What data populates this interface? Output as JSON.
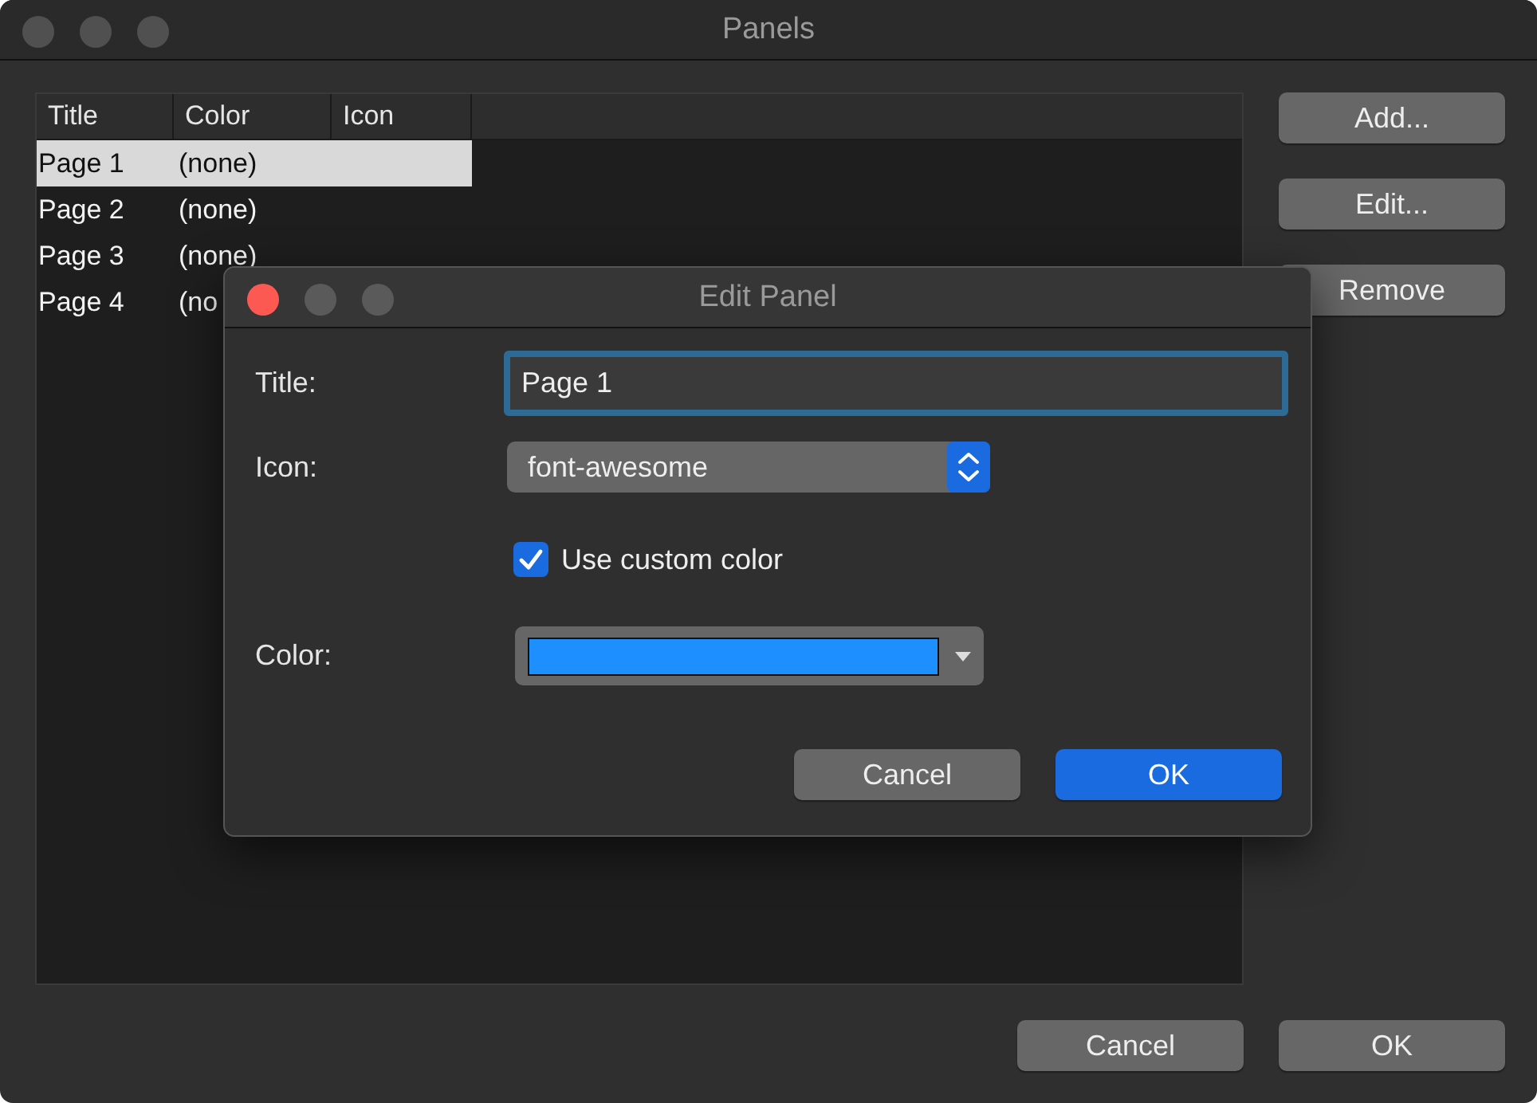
{
  "window": {
    "title": "Panels"
  },
  "table": {
    "columns": [
      "Title",
      "Color",
      "Icon"
    ],
    "rows": [
      {
        "cells": [
          "Page 1",
          "(none)"
        ],
        "selected": true
      },
      {
        "cells": [
          "Page 2",
          "(none)"
        ],
        "selected": false
      },
      {
        "cells": [
          "Page 3",
          "(none)"
        ],
        "selected": false
      },
      {
        "cells": [
          "Page 4",
          "(no"
        ],
        "selected": false
      }
    ]
  },
  "side_buttons": [
    "Add...",
    "Edit...",
    "Remove"
  ],
  "buttons": [
    "Cancel",
    "OK"
  ],
  "dialog": {
    "title": "Edit Panel",
    "title_field": {
      "label": "Title:",
      "value": "Page 1"
    },
    "icon_field": {
      "label": "Icon:",
      "value": "font-awesome"
    },
    "custom_color": {
      "label": "Use custom color",
      "checked": true
    },
    "color_field": {
      "label": "Color:",
      "color": "#1e8ffe"
    },
    "buttons": [
      {
        "label": "Cancel",
        "kind": "secondary"
      },
      {
        "label": "OK",
        "kind": "primary"
      }
    ]
  }
}
